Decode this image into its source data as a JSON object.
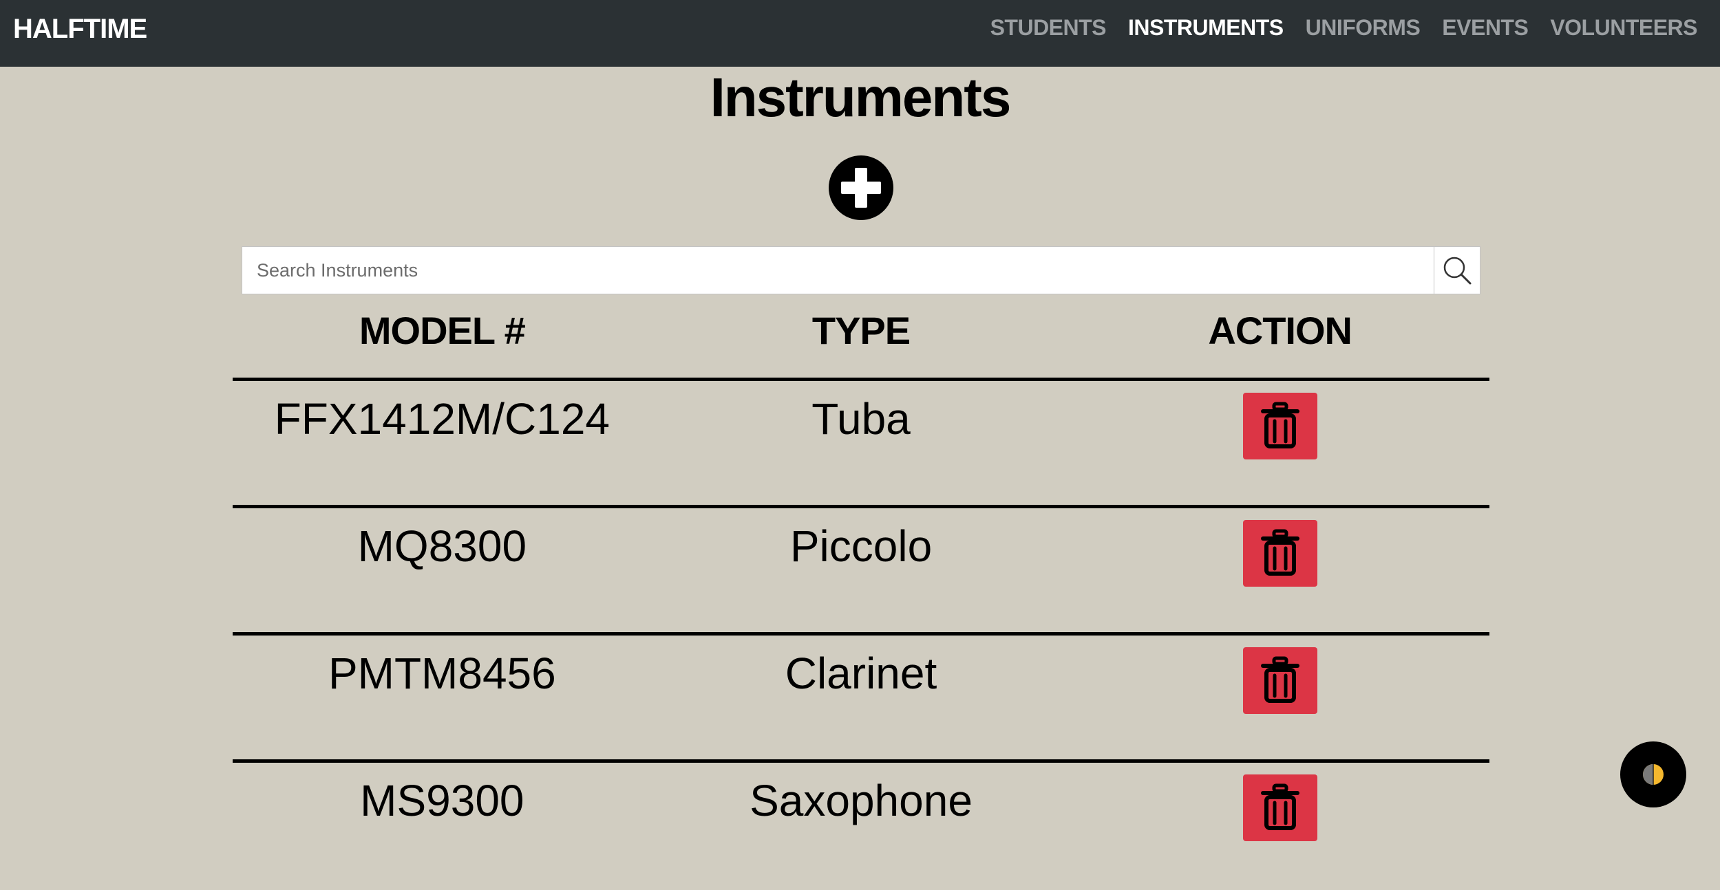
{
  "navbar": {
    "brand": "HALFTIME",
    "links": [
      {
        "label": "STUDENTS",
        "active": false
      },
      {
        "label": "INSTRUMENTS",
        "active": true
      },
      {
        "label": "UNIFORMS",
        "active": false
      },
      {
        "label": "EVENTS",
        "active": false
      },
      {
        "label": "VOLUNTEERS",
        "active": false
      }
    ]
  },
  "page": {
    "title": "Instruments",
    "add_icon": "plus-circle-icon"
  },
  "search": {
    "placeholder": "Search Instruments",
    "value": "",
    "icon": "search-icon"
  },
  "table": {
    "headers": [
      "MODEL #",
      "TYPE",
      "ACTION"
    ],
    "rows": [
      {
        "model": "FFX1412M/C124",
        "type": "Tuba"
      },
      {
        "model": "MQ8300",
        "type": "Piccolo"
      },
      {
        "model": "PMTM8456",
        "type": "Clarinet"
      },
      {
        "model": "MS9300",
        "type": "Saxophone"
      }
    ],
    "delete_icon": "trash-icon"
  },
  "theme_toggle": {
    "icon": "half-moon-icon"
  },
  "colors": {
    "navbar_bg": "#2b3134",
    "page_bg": "#d1cdc1",
    "delete_bg": "#dc3545",
    "nav_inactive": "#9b9fa2",
    "nav_active": "#ffffff",
    "toggle_accent": "#f5b82e"
  }
}
